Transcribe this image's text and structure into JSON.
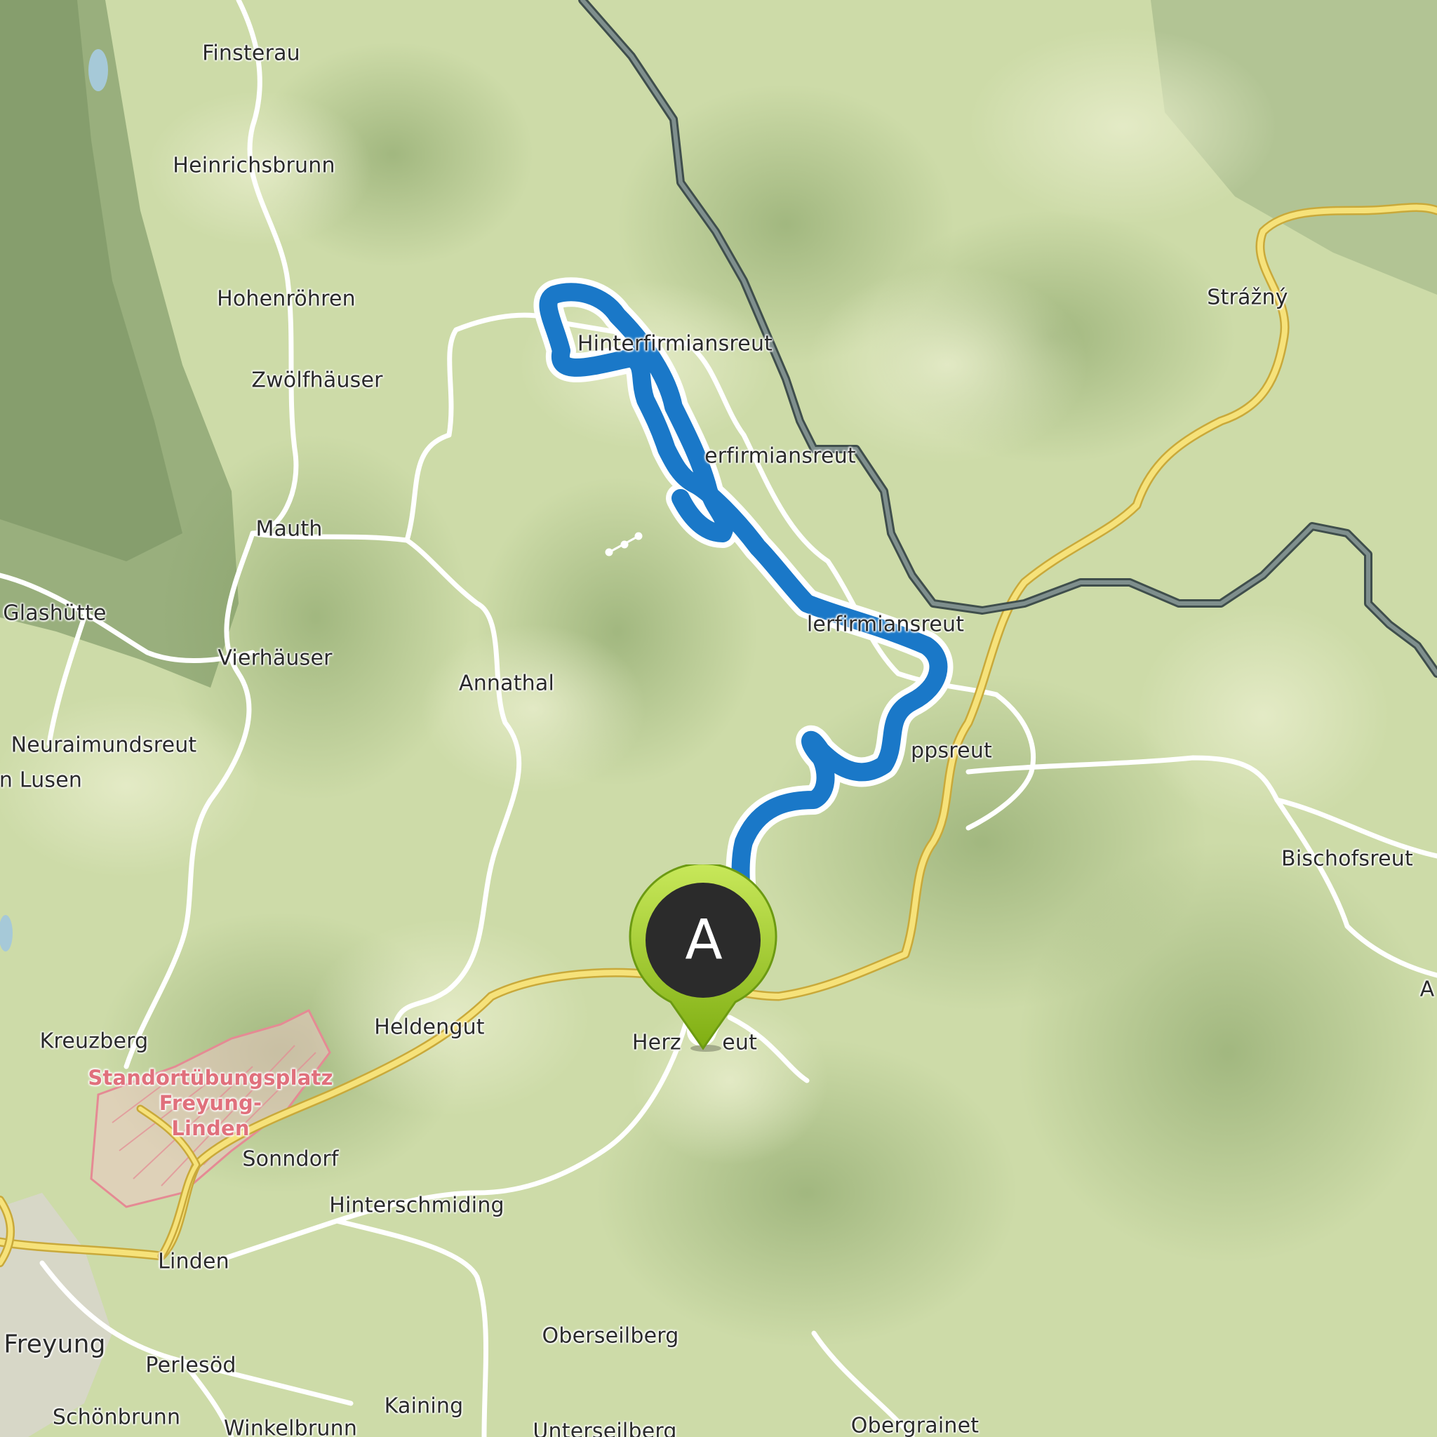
{
  "map": {
    "type": "topographic route map",
    "route_color": "#1a78c8",
    "road_major_color": "#f3dd6a",
    "border_color": "#5a6a68",
    "terrain_color": "#cfdcaa",
    "marker": {
      "letter": "A",
      "color": "#8fc11f",
      "icon": "map-pin-icon"
    },
    "places": [
      {
        "id": "finsterau",
        "name": "Finsterau"
      },
      {
        "id": "heinrichsbrunn",
        "name": "Heinrichsbrunn"
      },
      {
        "id": "hohenroehren",
        "name": "Hohenröhren"
      },
      {
        "id": "zwoelfhaeuser",
        "name": "Zwölfhäuser"
      },
      {
        "id": "mauth",
        "name": "Mauth"
      },
      {
        "id": "glashuette",
        "name": "Glashütte"
      },
      {
        "id": "vierhaeuser",
        "name": "Vierhäuser"
      },
      {
        "id": "neuraimundsreut",
        "name": "Neuraimundsreut"
      },
      {
        "id": "lusen",
        "name": "n Lusen"
      },
      {
        "id": "hinterfirmiansreut",
        "name": "Hinterfirmiansreut"
      },
      {
        "id": "mitterfirmiansreut",
        "name": "erfirmiansreut"
      },
      {
        "id": "vorderfirmiansreut",
        "name": "lerfirmiansreut"
      },
      {
        "id": "annathal",
        "name": "Annathal"
      },
      {
        "id": "philippsreut",
        "name": "ppsreut"
      },
      {
        "id": "strazny",
        "name": "Strážný"
      },
      {
        "id": "bischofsreut",
        "name": "Bischofsreut"
      },
      {
        "id": "kreuzberg",
        "name": "Kreuzberg"
      },
      {
        "id": "heldengut",
        "name": "Heldengut"
      },
      {
        "id": "herzogsreut",
        "name": "Herz      eut"
      },
      {
        "id": "sonndorf",
        "name": "Sonndorf"
      },
      {
        "id": "hinterschmiding",
        "name": "Hinterschmiding"
      },
      {
        "id": "linden",
        "name": "Linden"
      },
      {
        "id": "freyung",
        "name": "Freyung"
      },
      {
        "id": "perlesoed",
        "name": "Perlesöd"
      },
      {
        "id": "oberseilberg",
        "name": "Oberseilberg"
      },
      {
        "id": "schoenbrunn",
        "name": "Schönbrunn"
      },
      {
        "id": "kaining",
        "name": "Kaining"
      },
      {
        "id": "winkelbrunn",
        "name": "Winkelbrunn"
      },
      {
        "id": "unterseilberg",
        "name": "Unterseilberg"
      },
      {
        "id": "obergrainet",
        "name": "Obergrainet"
      },
      {
        "id": "edge-a",
        "name": "A"
      }
    ],
    "military_area": {
      "line1": "Standortübungsplatz",
      "line2": "Freyung-",
      "line3": "Linden"
    }
  }
}
